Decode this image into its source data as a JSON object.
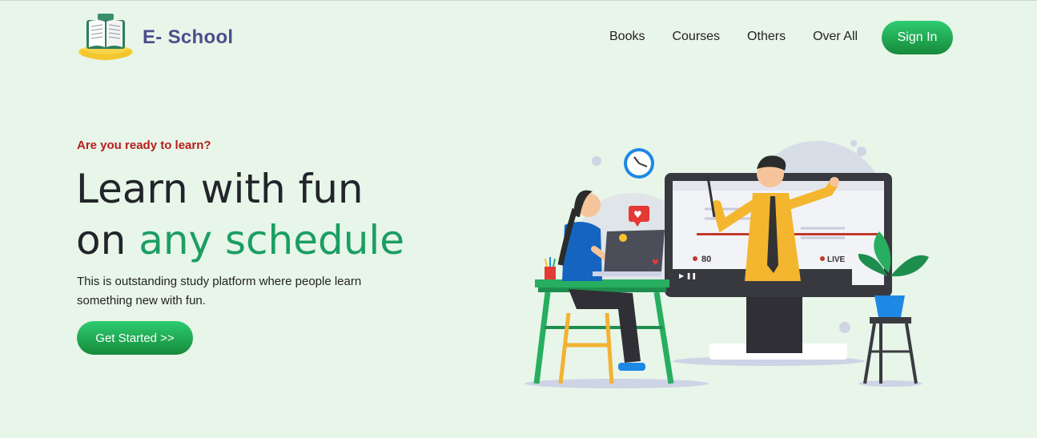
{
  "brand": {
    "name": "E- School",
    "logo_icon": "open-book-icon"
  },
  "nav": {
    "links": [
      "Books",
      "Courses",
      "Others",
      "Over All"
    ],
    "signin_label": "Sign In"
  },
  "hero": {
    "eyebrow": "Are you ready to learn?",
    "headline_line1": "Learn with fun",
    "headline_prefix": "on ",
    "headline_accent": "any schedule",
    "description": "This is outstanding study platform where people learn something new with fun.",
    "cta_label": "Get Started >>"
  },
  "illustration": {
    "viewer_count": "80",
    "live_label": "LIVE"
  },
  "colors": {
    "background": "#e8f5e9",
    "accent_green": "#1b9e62",
    "eyebrow_red": "#b71c1c",
    "brand_purple": "#4b4e8c"
  }
}
